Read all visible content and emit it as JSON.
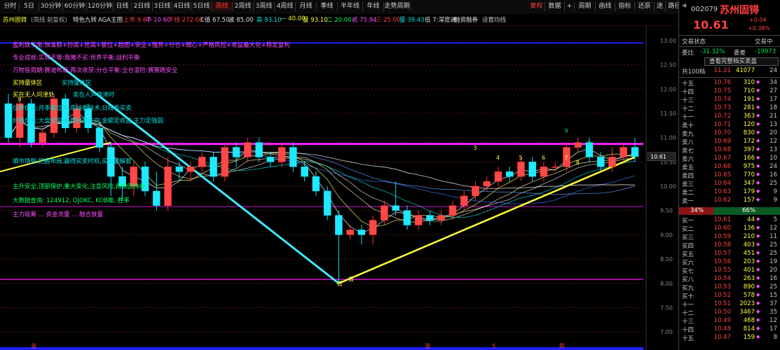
{
  "toolbar": {
    "period_tabs": [
      "分时",
      "5日",
      "30分钟",
      "60分钟",
      "120分钟",
      "日线",
      "2日线",
      "3日线",
      "4日线",
      "5日线",
      "周线",
      "2周线",
      "3周线",
      "4周线",
      "月线",
      "季线",
      "半年线",
      "年线",
      "走势周期"
    ],
    "active_tab": "周线",
    "right_buttons": [
      "复权",
      "数据",
      "+",
      "周期",
      "画线",
      "指标",
      "还原",
      "迷",
      "路径"
    ],
    "active_right": "复权"
  },
  "subbar": {
    "stock_name": "苏州固锝",
    "mode": "(周线 前复权)",
    "items": [
      {
        "label": "特色九转",
        "color": "#e0e0e0"
      },
      {
        "label": "AGA主图",
        "color": "#e0e0e0"
      },
      {
        "label": "上市 9.67",
        "color": "#ff4040"
      },
      {
        "label": "中 10.60",
        "color": "#ff50ff"
      },
      {
        "label": "下线 272.00",
        "color": "#ff4040"
      },
      {
        "label": "C值 67.50",
        "color": "#e0e0e0"
      },
      {
        "label": "波 85.00",
        "color": "#e0e0e0"
      },
      {
        "label": "高 93.10",
        "color": "#00e0e0"
      },
      {
        "label": "— 40.00",
        "color": "#ffff3c"
      },
      {
        "label": "量 93.10",
        "color": "#ffff3c"
      },
      {
        "label": "二 20.00",
        "color": "#00ff60"
      },
      {
        "label": "贰 75.94",
        "color": "#ff50ff"
      },
      {
        "label": "三 25.00",
        "color": "#ff4040"
      },
      {
        "label": "量 39.43",
        "color": "#00e0e0"
      },
      {
        "label": "低 7:深度通",
        "color": "#e0e0e0"
      },
      {
        "label": "融资融券",
        "color": "#e0e0e0"
      },
      {
        "label": "设置均线",
        "color": "#c0c0c0"
      }
    ]
  },
  "overlay": {
    "lines": [
      {
        "text": "盈利铁三角:快准稳+抄底+抢高+板位+趋图+安全+强势+分仓+细心+严格风控+收益最大化+稳定复利",
        "color": "#ff50ff"
      },
      {
        "text": "专业成就:实现不等:我赌不买:世界平衡:战利平衡",
        "color": "#ff50ff"
      },
      {
        "text": "万物皆周期:赛道布局:再次收获:分仓平衡:全仓混险:赛赛跑安全",
        "color": "#ff50ff"
      },
      {
        "text": "买持量体区",
        "color": "#ffff3c"
      },
      {
        "text": "买持量体区",
        "color": "#00e0e0"
      },
      {
        "text": "买在无人问津处",
        "color": "#ffff3c"
      },
      {
        "text": "卖在人声鼎沸时",
        "color": "#00e0e0"
      },
      {
        "text": "位势优先:月季看位势,周线看技术,日线看买卖",
        "color": "#00e0e0"
      },
      {
        "text": "价值优先:大盘定风格,题材定方向,金额定收益,主力定强弱",
        "color": "#00e0e0"
      },
      {
        "text": "顺市场势,把握布局,赢得买卖时机,买就要解套",
        "color": "#00e0e0"
      },
      {
        "text": "主升安全,顶部保护,重大变化,注意风险,再稳固持续",
        "color": "#00ff60"
      },
      {
        "text": "大数据查询: 124912, OJOKC, KOB推, 胜率",
        "color": "#00ff60"
      },
      {
        "text": "主力吸筹 ... 资金流量 ... 融合放量",
        "color": "#ff50ff"
      }
    ],
    "candle_labels": [
      "9",
      "9",
      "3",
      "4",
      "5",
      "6",
      "7",
      "8",
      "9",
      "低",
      "低"
    ],
    "marks": [
      "涨",
      "涨",
      "5",
      "跌",
      "跌"
    ]
  },
  "chart_data": {
    "type": "candlestick",
    "y_ticks": [
      "13.00",
      "12.50",
      "12.00",
      "11.50",
      "11.00",
      "10.50",
      "10.00",
      "9.50",
      "9.00",
      "8.50",
      "8.00",
      "7.50",
      "7.00"
    ],
    "last_price_tag": "10.61",
    "ylim": [
      6.8,
      13.2
    ],
    "candles": [
      [
        11.7,
        11.0,
        11.9,
        10.9
      ],
      [
        11.0,
        11.7,
        11.8,
        10.8
      ],
      [
        11.7,
        10.9,
        11.8,
        10.8
      ],
      [
        10.9,
        11.1,
        11.2,
        10.8
      ],
      [
        11.1,
        11.8,
        11.9,
        11.0
      ],
      [
        11.8,
        11.2,
        11.9,
        11.1
      ],
      [
        11.2,
        11.6,
        11.7,
        11.1
      ],
      [
        11.6,
        11.2,
        11.7,
        11.1
      ],
      [
        11.2,
        10.8,
        11.3,
        10.7
      ],
      [
        10.8,
        10.2,
        10.9,
        9.8
      ],
      [
        10.2,
        10.0,
        10.4,
        9.7
      ],
      [
        10.0,
        10.4,
        10.5,
        9.8
      ],
      [
        10.4,
        9.9,
        10.5,
        9.8
      ],
      [
        9.9,
        9.6,
        10.3,
        9.5
      ],
      [
        9.6,
        10.4,
        10.6,
        9.5
      ],
      [
        10.4,
        10.3,
        10.5,
        10.1
      ],
      [
        10.3,
        10.4,
        10.5,
        10.1
      ],
      [
        10.4,
        10.6,
        10.7,
        10.3
      ],
      [
        10.6,
        10.2,
        10.7,
        10.1
      ],
      [
        10.2,
        10.8,
        10.9,
        10.1
      ],
      [
        10.8,
        10.6,
        10.9,
        10.4
      ],
      [
        10.6,
        10.9,
        11.0,
        10.5
      ],
      [
        10.9,
        10.6,
        11.0,
        10.5
      ],
      [
        10.6,
        10.5,
        10.7,
        10.4
      ],
      [
        10.5,
        10.8,
        10.9,
        10.4
      ],
      [
        10.8,
        10.4,
        10.9,
        10.3
      ],
      [
        10.4,
        10.2,
        10.5,
        10.1
      ],
      [
        10.2,
        9.9,
        10.3,
        9.8
      ],
      [
        9.9,
        9.4,
        10.0,
        9.3
      ],
      [
        9.4,
        9.0,
        9.5,
        8.0
      ],
      [
        9.0,
        9.1,
        9.2,
        8.9
      ],
      [
        9.1,
        9.0,
        9.2,
        8.8
      ],
      [
        9.0,
        9.3,
        9.4,
        8.8
      ],
      [
        9.3,
        9.6,
        9.7,
        9.2
      ],
      [
        9.6,
        9.5,
        10.1,
        9.4
      ],
      [
        9.5,
        9.2,
        9.6,
        9.1
      ],
      [
        9.2,
        9.4,
        9.5,
        9.1
      ],
      [
        9.4,
        9.3,
        9.5,
        9.2
      ],
      [
        9.3,
        9.4,
        9.5,
        9.2
      ],
      [
        9.4,
        9.6,
        9.7,
        9.3
      ],
      [
        9.6,
        9.8,
        9.9,
        9.5
      ],
      [
        9.8,
        10.0,
        10.1,
        9.7
      ],
      [
        10.0,
        10.1,
        10.2,
        9.9
      ],
      [
        10.1,
        10.3,
        10.4,
        10.0
      ],
      [
        10.3,
        10.2,
        10.4,
        10.1
      ],
      [
        10.2,
        10.5,
        10.6,
        10.1
      ],
      [
        10.5,
        10.2,
        10.6,
        10.1
      ],
      [
        10.2,
        10.4,
        10.5,
        10.1
      ],
      [
        10.4,
        10.4,
        10.5,
        10.3
      ],
      [
        10.4,
        10.8,
        10.9,
        10.3
      ],
      [
        10.8,
        10.9,
        11.0,
        10.7
      ],
      [
        10.9,
        10.6,
        11.0,
        10.5
      ],
      [
        10.6,
        10.4,
        10.7,
        10.3
      ],
      [
        10.4,
        10.6,
        10.8,
        10.3
      ],
      [
        10.6,
        10.8,
        10.9,
        10.5
      ],
      [
        10.8,
        10.61,
        11.0,
        10.5
      ]
    ]
  },
  "right_panel": {
    "code": "002079",
    "name": "苏州固锝",
    "price": "10.61",
    "change": "+0.04",
    "change_pct": "+0.38%",
    "trade_status_label": "交易状态",
    "trade_status": "交易中",
    "weibi_label": "委比",
    "weibi": "-31.32%",
    "weicha_label": "委差",
    "weicha": "-19973",
    "full_book_button": "查看完整档买卖盘",
    "total_label": "共100档",
    "total_price": "11.21",
    "total_vol": "41077",
    "total_count": "24",
    "asks": [
      {
        "label": "十五",
        "price": "10.76",
        "vol": "310",
        "mark": "◆",
        "count": "34"
      },
      {
        "label": "十四",
        "price": "10.75",
        "vol": "710",
        "mark": "◆",
        "count": "27"
      },
      {
        "label": "十三",
        "price": "10.74",
        "vol": "191",
        "mark": "◆",
        "count": "17"
      },
      {
        "label": "十二",
        "price": "10.73",
        "vol": "281",
        "mark": "◆",
        "count": "18"
      },
      {
        "label": "十一",
        "price": "10.72",
        "vol": "363",
        "mark": "◆",
        "count": "21"
      },
      {
        "label": "卖十",
        "price": "10.71",
        "vol": "120",
        "mark": "◆",
        "count": "13"
      },
      {
        "label": "卖九",
        "price": "10.70",
        "vol": "830",
        "mark": "◆",
        "count": "20"
      },
      {
        "label": "卖八",
        "price": "10.69",
        "vol": "172",
        "mark": "◆",
        "count": "12"
      },
      {
        "label": "卖七",
        "price": "10.68",
        "vol": "397",
        "mark": "◆",
        "count": "13"
      },
      {
        "label": "卖六",
        "price": "10.67",
        "vol": "166",
        "mark": "◆",
        "count": "10"
      },
      {
        "label": "卖五",
        "price": "10.66",
        "vol": "975",
        "mark": "◆",
        "count": "24"
      },
      {
        "label": "卖四",
        "price": "10.65",
        "vol": "770",
        "mark": "◆",
        "count": "16"
      },
      {
        "label": "卖三",
        "price": "10.64",
        "vol": "347",
        "mark": "◆",
        "count": "25"
      },
      {
        "label": "卖二",
        "price": "10.63",
        "vol": "179",
        "mark": "◆",
        "count": "9"
      },
      {
        "label": "卖一",
        "price": "10.62",
        "vol": "157",
        "mark": "◆",
        "count": "9"
      }
    ],
    "ratio_buy": "34%",
    "ratio_sell": "66%",
    "bids": [
      {
        "label": "买一",
        "price": "10.61",
        "vol": "44",
        "mark": "◆",
        "count": "5"
      },
      {
        "label": "买二",
        "price": "10.60",
        "vol": "136",
        "mark": "◆",
        "count": "12"
      },
      {
        "label": "买三",
        "price": "10.59",
        "vol": "210",
        "mark": "◆",
        "count": "11"
      },
      {
        "label": "买四",
        "price": "10.58",
        "vol": "403",
        "mark": "◆",
        "count": "25"
      },
      {
        "label": "买五",
        "price": "10.57",
        "vol": "451",
        "mark": "◆",
        "count": "25"
      },
      {
        "label": "买六",
        "price": "10.56",
        "vol": "203",
        "mark": "◆",
        "count": "19"
      },
      {
        "label": "买七",
        "price": "10.55",
        "vol": "401",
        "mark": "◆",
        "count": "20"
      },
      {
        "label": "买八",
        "price": "10.54",
        "vol": "263",
        "mark": "◆",
        "count": "16"
      },
      {
        "label": "买九",
        "price": "10.53",
        "vol": "890",
        "mark": "◆",
        "count": "25"
      },
      {
        "label": "买十",
        "price": "10.52",
        "vol": "578",
        "mark": "◆",
        "count": "15"
      },
      {
        "label": "十一",
        "price": "10.51",
        "vol": "2023",
        "mark": "◆",
        "count": "37"
      },
      {
        "label": "十二",
        "price": "10.50",
        "vol": "3467",
        "mark": "◆",
        "count": "35"
      },
      {
        "label": "十三",
        "price": "10.49",
        "vol": "468",
        "mark": "◆",
        "count": "12"
      },
      {
        "label": "十四",
        "price": "10.48",
        "vol": "814",
        "mark": "◆",
        "count": "17"
      },
      {
        "label": "十五",
        "price": "10.47",
        "vol": "159",
        "mark": "◆",
        "count": "8"
      }
    ]
  },
  "colors": {
    "up": "#ff3030",
    "down": "#00e0ff",
    "yellow": "#ffff3c",
    "magenta": "#ff00ff",
    "blue": "#2020ff"
  }
}
